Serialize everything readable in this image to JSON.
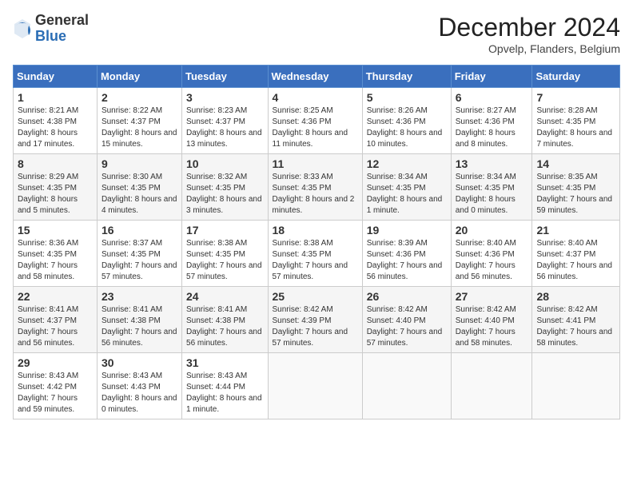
{
  "logo": {
    "general": "General",
    "blue": "Blue"
  },
  "header": {
    "month": "December 2024",
    "location": "Opvelp, Flanders, Belgium"
  },
  "columns": [
    "Sunday",
    "Monday",
    "Tuesday",
    "Wednesday",
    "Thursday",
    "Friday",
    "Saturday"
  ],
  "weeks": [
    [
      {
        "day": "1",
        "info": "Sunrise: 8:21 AM\nSunset: 4:38 PM\nDaylight: 8 hours and 17 minutes."
      },
      {
        "day": "2",
        "info": "Sunrise: 8:22 AM\nSunset: 4:37 PM\nDaylight: 8 hours and 15 minutes."
      },
      {
        "day": "3",
        "info": "Sunrise: 8:23 AM\nSunset: 4:37 PM\nDaylight: 8 hours and 13 minutes."
      },
      {
        "day": "4",
        "info": "Sunrise: 8:25 AM\nSunset: 4:36 PM\nDaylight: 8 hours and 11 minutes."
      },
      {
        "day": "5",
        "info": "Sunrise: 8:26 AM\nSunset: 4:36 PM\nDaylight: 8 hours and 10 minutes."
      },
      {
        "day": "6",
        "info": "Sunrise: 8:27 AM\nSunset: 4:36 PM\nDaylight: 8 hours and 8 minutes."
      },
      {
        "day": "7",
        "info": "Sunrise: 8:28 AM\nSunset: 4:35 PM\nDaylight: 8 hours and 7 minutes."
      }
    ],
    [
      {
        "day": "8",
        "info": "Sunrise: 8:29 AM\nSunset: 4:35 PM\nDaylight: 8 hours and 5 minutes."
      },
      {
        "day": "9",
        "info": "Sunrise: 8:30 AM\nSunset: 4:35 PM\nDaylight: 8 hours and 4 minutes."
      },
      {
        "day": "10",
        "info": "Sunrise: 8:32 AM\nSunset: 4:35 PM\nDaylight: 8 hours and 3 minutes."
      },
      {
        "day": "11",
        "info": "Sunrise: 8:33 AM\nSunset: 4:35 PM\nDaylight: 8 hours and 2 minutes."
      },
      {
        "day": "12",
        "info": "Sunrise: 8:34 AM\nSunset: 4:35 PM\nDaylight: 8 hours and 1 minute."
      },
      {
        "day": "13",
        "info": "Sunrise: 8:34 AM\nSunset: 4:35 PM\nDaylight: 8 hours and 0 minutes."
      },
      {
        "day": "14",
        "info": "Sunrise: 8:35 AM\nSunset: 4:35 PM\nDaylight: 7 hours and 59 minutes."
      }
    ],
    [
      {
        "day": "15",
        "info": "Sunrise: 8:36 AM\nSunset: 4:35 PM\nDaylight: 7 hours and 58 minutes."
      },
      {
        "day": "16",
        "info": "Sunrise: 8:37 AM\nSunset: 4:35 PM\nDaylight: 7 hours and 57 minutes."
      },
      {
        "day": "17",
        "info": "Sunrise: 8:38 AM\nSunset: 4:35 PM\nDaylight: 7 hours and 57 minutes."
      },
      {
        "day": "18",
        "info": "Sunrise: 8:38 AM\nSunset: 4:35 PM\nDaylight: 7 hours and 57 minutes."
      },
      {
        "day": "19",
        "info": "Sunrise: 8:39 AM\nSunset: 4:36 PM\nDaylight: 7 hours and 56 minutes."
      },
      {
        "day": "20",
        "info": "Sunrise: 8:40 AM\nSunset: 4:36 PM\nDaylight: 7 hours and 56 minutes."
      },
      {
        "day": "21",
        "info": "Sunrise: 8:40 AM\nSunset: 4:37 PM\nDaylight: 7 hours and 56 minutes."
      }
    ],
    [
      {
        "day": "22",
        "info": "Sunrise: 8:41 AM\nSunset: 4:37 PM\nDaylight: 7 hours and 56 minutes."
      },
      {
        "day": "23",
        "info": "Sunrise: 8:41 AM\nSunset: 4:38 PM\nDaylight: 7 hours and 56 minutes."
      },
      {
        "day": "24",
        "info": "Sunrise: 8:41 AM\nSunset: 4:38 PM\nDaylight: 7 hours and 56 minutes."
      },
      {
        "day": "25",
        "info": "Sunrise: 8:42 AM\nSunset: 4:39 PM\nDaylight: 7 hours and 57 minutes."
      },
      {
        "day": "26",
        "info": "Sunrise: 8:42 AM\nSunset: 4:40 PM\nDaylight: 7 hours and 57 minutes."
      },
      {
        "day": "27",
        "info": "Sunrise: 8:42 AM\nSunset: 4:40 PM\nDaylight: 7 hours and 58 minutes."
      },
      {
        "day": "28",
        "info": "Sunrise: 8:42 AM\nSunset: 4:41 PM\nDaylight: 7 hours and 58 minutes."
      }
    ],
    [
      {
        "day": "29",
        "info": "Sunrise: 8:43 AM\nSunset: 4:42 PM\nDaylight: 7 hours and 59 minutes."
      },
      {
        "day": "30",
        "info": "Sunrise: 8:43 AM\nSunset: 4:43 PM\nDaylight: 8 hours and 0 minutes."
      },
      {
        "day": "31",
        "info": "Sunrise: 8:43 AM\nSunset: 4:44 PM\nDaylight: 8 hours and 1 minute."
      },
      null,
      null,
      null,
      null
    ]
  ]
}
